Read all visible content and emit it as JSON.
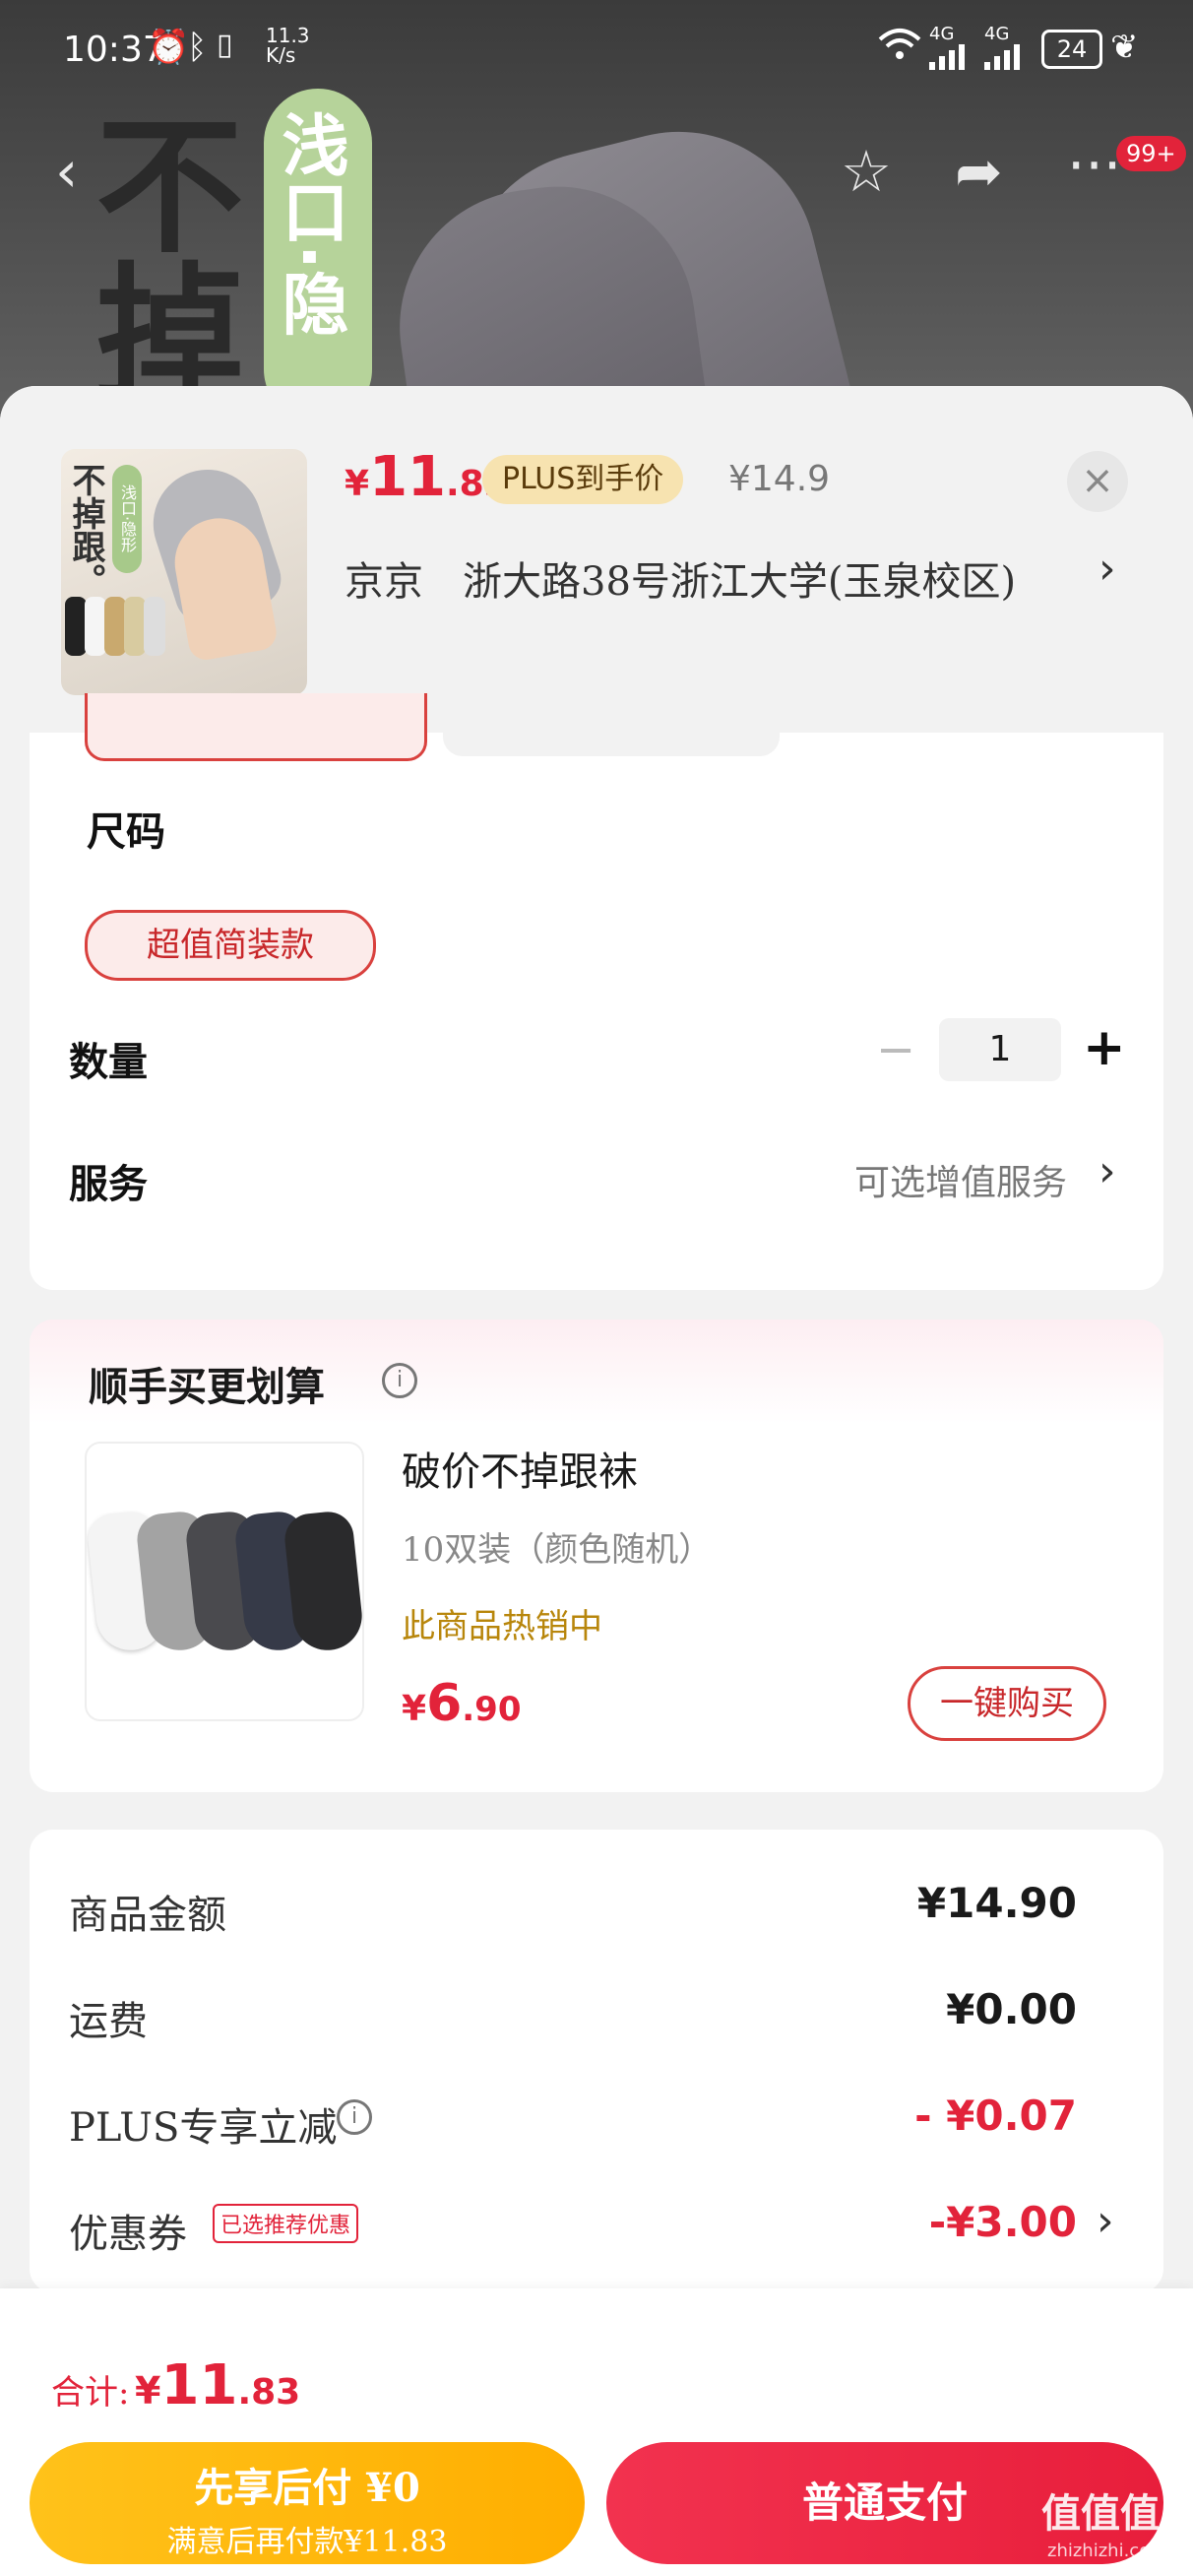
{
  "status_bar": {
    "time": "10:37",
    "net_speed": "11.3\nK/s",
    "signal1": "4G",
    "signal2": "4G",
    "battery": "24"
  },
  "hero": {
    "headline": "不掉",
    "tag": "浅口·隐"
  },
  "nav": {
    "badge": "99+"
  },
  "product": {
    "price_symbol": "¥",
    "price_int": "11",
    "price_dec": ".83",
    "plus_tag": "PLUS到手价",
    "original_price": "¥14.9",
    "address": "京京　浙大路38号浙江大学(玉泉校区)",
    "address_arrow": "›",
    "close_icon": "×",
    "thumb_text": "不掉跟。",
    "thumb_tag": "浅口·隐形"
  },
  "specs": {
    "size_label": "尺码",
    "size_option": "超值简装款",
    "quantity_label": "数量",
    "quantity_minus": "−",
    "quantity_value": "1",
    "quantity_plus": "+",
    "service_label": "服务",
    "service_value": "可选增值服务",
    "service_arrow": "›"
  },
  "bundle": {
    "title": "顺手买更划算",
    "info_icon": "i",
    "item_name": "破价不掉跟袜",
    "item_desc": "10双装（颜色随机）",
    "item_hot": "此商品热销中",
    "item_price_symbol": "¥",
    "item_price_int": "6",
    "item_price_dec": ".90",
    "buy_button": "一键购买"
  },
  "summary": {
    "rows": [
      {
        "label": "商品金额",
        "value": "¥14.90"
      },
      {
        "label": "运费",
        "value": "¥0.00"
      },
      {
        "label": "PLUS专享立减",
        "value": "- ¥0.07"
      },
      {
        "label": "优惠券",
        "value": "-¥3.00"
      }
    ],
    "coupon_tag": "已选推荐优惠",
    "coupon_arrow": "›"
  },
  "footer": {
    "total_label": "合计:",
    "total_symbol": "¥",
    "total_int": "11",
    "total_dec": ".83",
    "pay_later_title": "先享后付 ¥0",
    "pay_later_sub": "满意后再付款¥11.83",
    "pay_normal": "普通支付",
    "watermark": "值值值",
    "watermark_url": "zhizhizhi.com"
  },
  "colors": {
    "accent_red": "#e2233a",
    "accent_yellow": "#ffb400",
    "hot_gold": "#b8860b"
  }
}
